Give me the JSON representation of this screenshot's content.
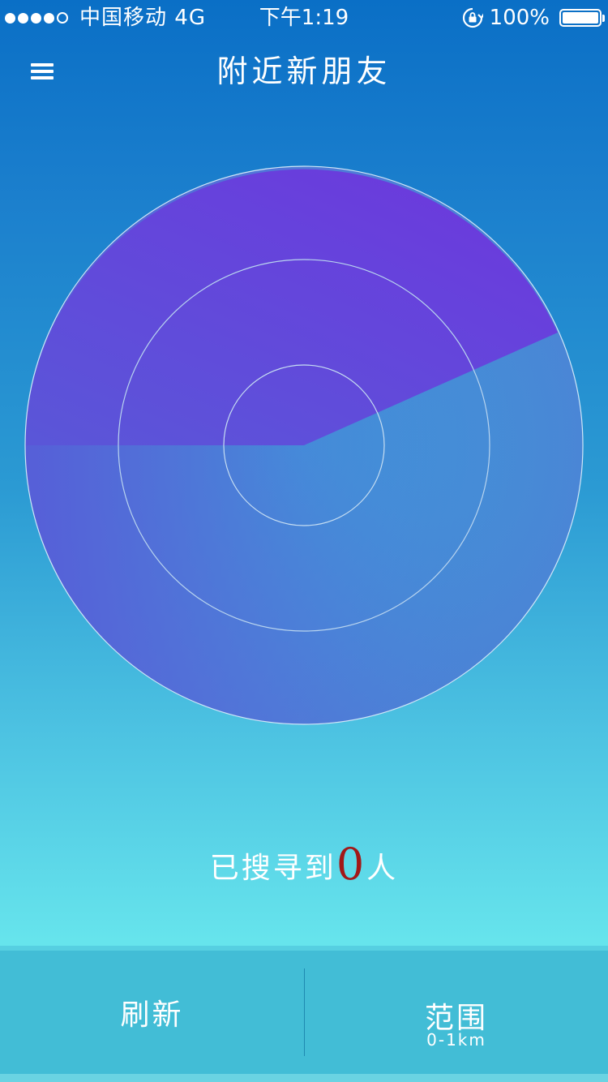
{
  "status_bar": {
    "carrier": "中国移动",
    "network": "4G",
    "time": "下午1:19",
    "battery": "100%"
  },
  "nav": {
    "title": "附近新朋友",
    "menu_icon": "menu-icon"
  },
  "radar": {
    "ring_count": 3,
    "sweep_color": "#6a30dc",
    "base_color": "#3a9bd3"
  },
  "results": {
    "prefix": "已搜寻到",
    "count": "0",
    "suffix": "人"
  },
  "bottom_bar": {
    "refresh_label": "刷新",
    "range_label": "范围",
    "range_value": "0-1km"
  },
  "colors": {
    "count_color": "#a21818",
    "bottom_bar_bg": "#42bdd6"
  }
}
